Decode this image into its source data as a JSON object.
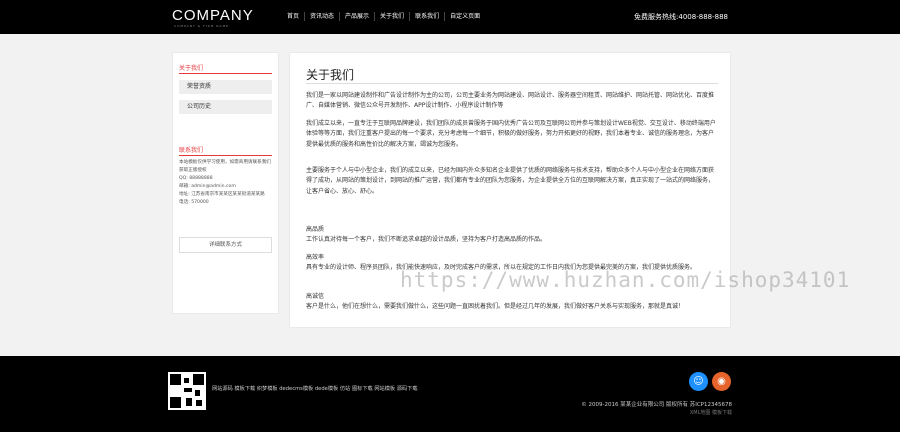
{
  "header": {
    "logo": "COMPANY",
    "logo_sub": "COMPANY & FIRM NAME",
    "nav": [
      "首页",
      "资讯动态",
      "产品展示",
      "关于我们",
      "联系我们",
      "自定义页面"
    ],
    "hotline": "免费服务热线:4008-888-888"
  },
  "sidebar": {
    "title": "关于我们",
    "items": [
      "荣誉资质",
      "公司历史"
    ],
    "contact_title": "联系我们",
    "contact_lines": [
      "本站模板仅供学习使用，如需商用请联系我们获取正版授权",
      "QQ: 88888888",
      "邮箱: admin@admin.com",
      "地址: 江苏省南京市某某区某某街道某某路",
      "电话: 570000"
    ],
    "button": "详细联系方式"
  },
  "main": {
    "title": "关于我们",
    "paragraphs": [
      "我们是一家以网站建设制作和广告设计制作为主的公司，公司主要业务为网站建设、网站设计、服务器空间租赁、网站维护、网站托管、网站优化、百度推广、自媒体营销、微信公众号开发制作、APP设计制作、小程序设计制作等",
      "我们成立以来，一直专注于互联网品牌建设，我们团队的成员曾服务于国内优秀广告公司及互联网公司并参与策划设计WEB视觉、交互设计、移动终端用户体验等等方面，我们注重客户提出的每一个要求，充分考虑每一个细节，积极的做好服务，努力开拓更好的视野，我们本着专业、诚信的服务理念，为客户提供最优质的服务和高性价比的解决方案，竭诚为您服务。",
      "主要服务于个人与中小型企业，我们的成立以来，已经为国内外众多知名企业提供了优质的网络服务与技术支持，帮助众多个人与中小型企业在网络方面获得了成功，从网站的策划设计，到网站的推广运营，我们都有专业的团队为您服务，为企业提供全方位的互联网解决方案，真正实现了一站式的网络服务，让客户省心、放心、舒心。",
      "高品质\n工作认真对待每一个客户，我们不断追求卓越的设计品质，坚持为客户打造高品质的作品。",
      "高效率\n具有专业的设计师、程序员团队，我们能快速响应，及时完成客户的需求，所以在规定的工作日内我们为您提供最完美的方案，我们提供优质服务。",
      "高诚信\n客户是什么，他们在想什么，需要我们做什么，这些问题一直困扰着我们。但是经过几年的发展，我们做好客户关系与实现服务，那就是真诚！"
    ]
  },
  "watermark": "https://www.huzhan.com/ishop34101",
  "footer": {
    "links": [
      "网站源码",
      "模板下载",
      "织梦模板",
      "dedecms模板",
      "dede模板",
      "仿站",
      "图标下载",
      "网站模板",
      "源码下载"
    ],
    "copyright": "© 2009-2016 某某企业有限公司 版权所有   苏ICP12345678",
    "small": "XML地图   模板下载"
  },
  "colors": {
    "accent": "#e4393c",
    "topbar": "#000000",
    "qq": "#1e90ff",
    "weibo": "#e6632b"
  }
}
